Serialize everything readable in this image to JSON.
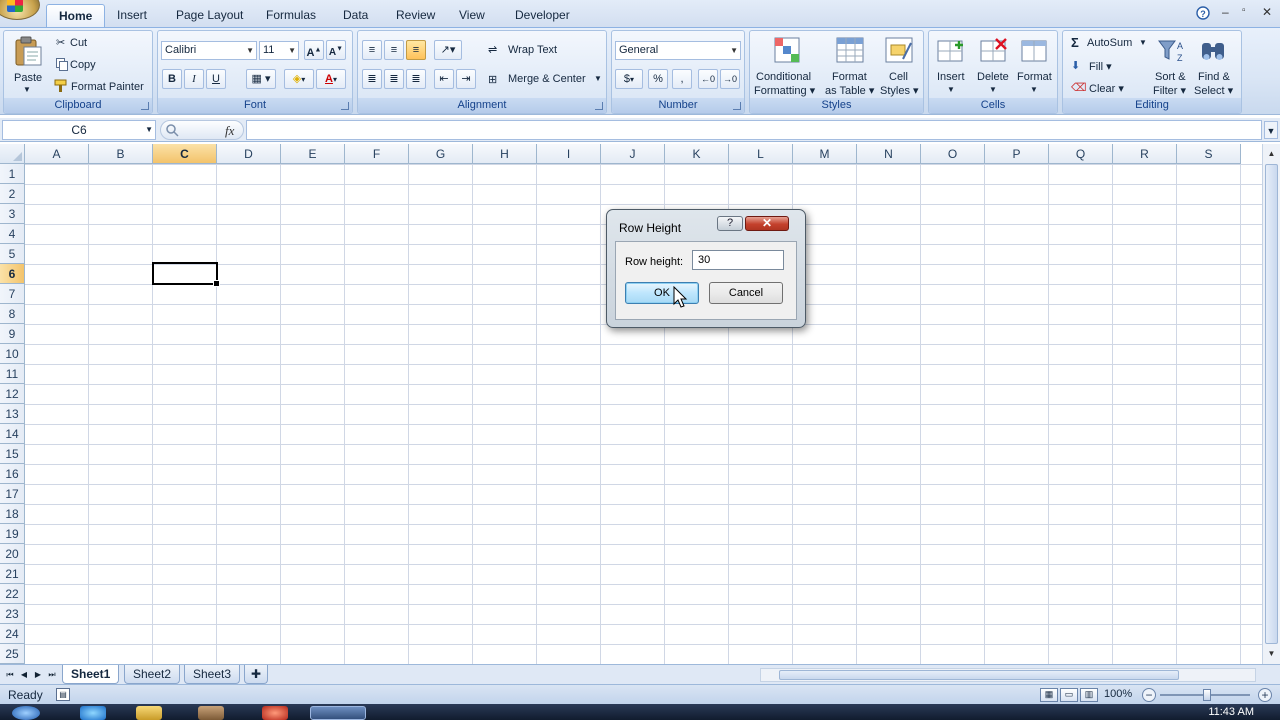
{
  "ribbon_tabs": [
    "Home",
    "Insert",
    "Page Layout",
    "Formulas",
    "Data",
    "Review",
    "View",
    "Developer"
  ],
  "active_tab": "Home",
  "clipboard": {
    "paste": "Paste",
    "cut": "Cut",
    "copy": "Copy",
    "format_painter": "Format Painter",
    "label": "Clipboard"
  },
  "font": {
    "name": "Calibri",
    "size": "11",
    "bold": "B",
    "italic": "I",
    "underline": "U",
    "label": "Font"
  },
  "alignment": {
    "wrap_text": "Wrap Text",
    "merge_center": "Merge & Center",
    "label": "Alignment"
  },
  "number": {
    "format": "General",
    "currency": "$",
    "percent": "%",
    "comma": ",",
    "label": "Number"
  },
  "styles": {
    "conditional_1": "Conditional",
    "conditional_2": "Formatting",
    "format_table_1": "Format",
    "format_table_2": "as Table",
    "cell_styles_1": "Cell",
    "cell_styles_2": "Styles",
    "label": "Styles"
  },
  "cells": {
    "insert": "Insert",
    "delete": "Delete",
    "format": "Format",
    "label": "Cells"
  },
  "editing": {
    "autosum": "AutoSum",
    "fill": "Fill",
    "clear": "Clear",
    "sort_1": "Sort &",
    "sort_2": "Filter",
    "find_1": "Find &",
    "find_2": "Select",
    "label": "Editing"
  },
  "name_box": "C6",
  "fx": "fx",
  "columns": [
    "A",
    "B",
    "C",
    "D",
    "E",
    "F",
    "G",
    "H",
    "I",
    "J",
    "K",
    "L",
    "M",
    "N",
    "O",
    "P",
    "Q",
    "R",
    "S"
  ],
  "rows": [
    "1",
    "2",
    "3",
    "4",
    "5",
    "6",
    "7",
    "8",
    "9",
    "10",
    "11",
    "12",
    "13",
    "14",
    "15",
    "16",
    "17",
    "18",
    "19",
    "20",
    "21",
    "22",
    "23",
    "24",
    "25"
  ],
  "selected_column": "C",
  "selected_row": "6",
  "sheets": [
    "Sheet1",
    "Sheet2",
    "Sheet3"
  ],
  "active_sheet": "Sheet1",
  "status": "Ready",
  "zoom": "100%",
  "clock": "11:43 AM",
  "dialog": {
    "title": "Row Height",
    "help": "?",
    "close": "x",
    "field_label": "Row height:",
    "field_value": "30",
    "ok": "OK",
    "cancel": "Cancel"
  }
}
